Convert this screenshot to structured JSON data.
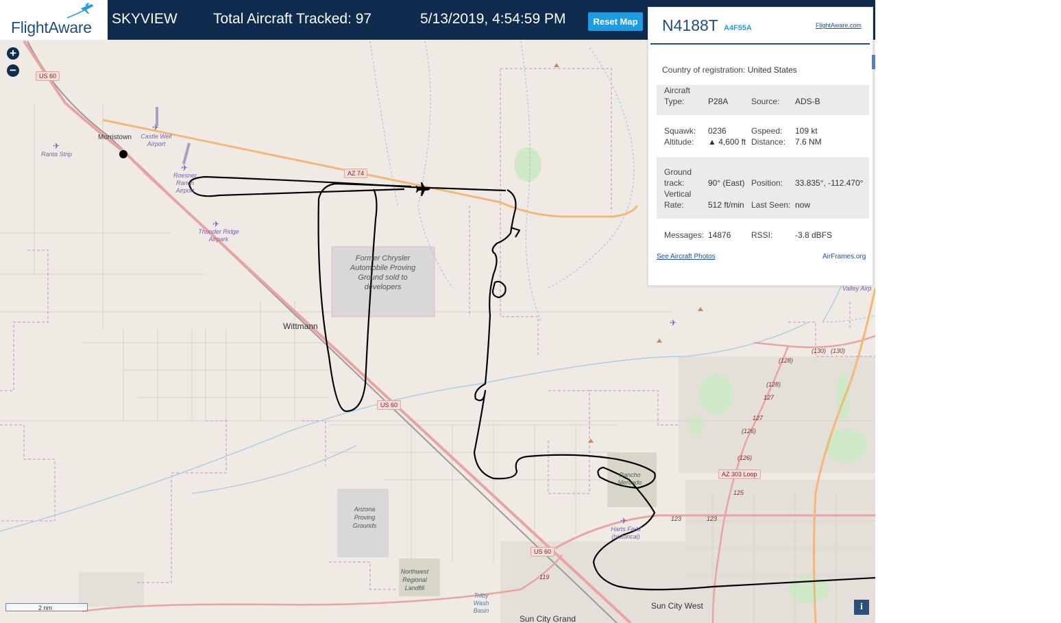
{
  "header": {
    "logo": "FlightAware",
    "app_title": "SKYVIEW",
    "aircraft_tracked": "Total Aircraft Tracked: 97",
    "datetime": "5/13/2019, 4:54:59 PM",
    "reset_label": "Reset Map"
  },
  "map": {
    "zoom_in": "+",
    "zoom_out": "−",
    "scale_label": "2 nm",
    "info_label": "i",
    "towns": [
      "Morristown",
      "Wittmann",
      "Sun City West",
      "Sun City Grand"
    ],
    "airports": {
      "ranta": "Ranta Strip",
      "castle_well": "Castle Well Airport",
      "roesner": "Roesner Ranch Airport",
      "thunder_ridge": "Thunder Ridge Airpark",
      "harts_field": "Harts Field (historical)",
      "valley": "Valley Airp"
    },
    "routes": {
      "us60_a": "US 60",
      "us60_b": "US 60",
      "us60_c": "US 60",
      "az74": "AZ 74",
      "az303": "AZ 303 Loop"
    },
    "areas": {
      "chrysler": "Former Chrysler Automobile Proving Ground sold to developers",
      "arizona_pg": "Arizona Proving Grounds",
      "landfill": "Northwest Regional Landfill",
      "trilby": "Trilby Wash Basin",
      "rancho": "Rancho Mercado"
    },
    "road_numbers": [
      "(128)",
      "(130)",
      "(130)",
      "(128)",
      "127",
      "127",
      "(126)",
      "(126)",
      "125",
      "123",
      "123",
      "119"
    ]
  },
  "aircraft": {
    "registration": "N4188T",
    "hex": "A4F55A",
    "flightaware_link": "FlightAware.com",
    "country_label": "Country of registration:",
    "country": "United States",
    "type_label": "Aircraft Type:",
    "type": "P28A",
    "source_label": "Source:",
    "source": "ADS-B",
    "squawk_label": "Squawk:",
    "squawk": "0236",
    "gspeed_label": "Gspeed:",
    "gspeed": "109 kt",
    "altitude_label": "Altitude:",
    "altitude": "▲ 4,600 ft",
    "distance_label": "Distance:",
    "distance": "7.6 NM",
    "track_label": "Ground track:",
    "track": "90° (East)",
    "position_label": "Position:",
    "position": "33.835°, -112.470°",
    "vrate_label": "Vertical Rate:",
    "vrate": "512 ft/min",
    "last_seen_label": "Last Seen:",
    "last_seen": "now",
    "messages_label": "Messages:",
    "messages": "14876",
    "rssi_label": "RSSI:",
    "rssi": "-3.8 dBFS",
    "photos_link": "See Aircraft Photos",
    "airframes_link": "AirFrames.org"
  },
  "colors": {
    "header_bg": "#0f2b4e",
    "accent": "#1e9be1",
    "map_bg": "#efeae4",
    "track": "#000000"
  }
}
